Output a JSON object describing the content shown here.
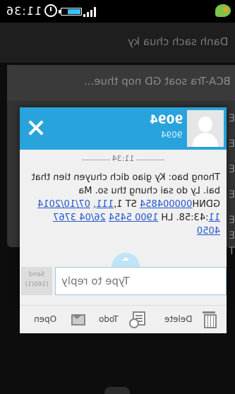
{
  "status_bar": {
    "time": "11:36",
    "icons": [
      "signal-icon",
      "battery-icon",
      "alarm-icon",
      "notification-icon"
    ]
  },
  "background": {
    "header": "Danh sach chua ky",
    "thread_title": "BCA-Tra soat GD nop thue...",
    "row_letters": [
      "E",
      "E",
      "E",
      "E",
      "E",
      "E",
      "T"
    ]
  },
  "popup": {
    "sender_name": "9094",
    "sender_number": "9094",
    "time": "11:34",
    "message_text": "Thong bao: Ky giao dich chuyen tien that bai. Ly do sai chung thu so. Ma GDNH",
    "message_link_code": "000004854",
    "message_mid": " ST 1,",
    "message_link_amount": "111,",
    "message_link_date": "07/10/2014 11",
    "message_time_rest": ":43:58. LH ",
    "message_link_phone1": "1900 5454",
    "message_link_phone2": "26/04 3767 4050",
    "reply_placeholder": "Type to reply",
    "send_label": "Send",
    "send_count": "(160/1)",
    "accent_color": "#29a3dc"
  },
  "actions": {
    "open": "Open",
    "todo": "Todo",
    "delete": "Delete"
  }
}
